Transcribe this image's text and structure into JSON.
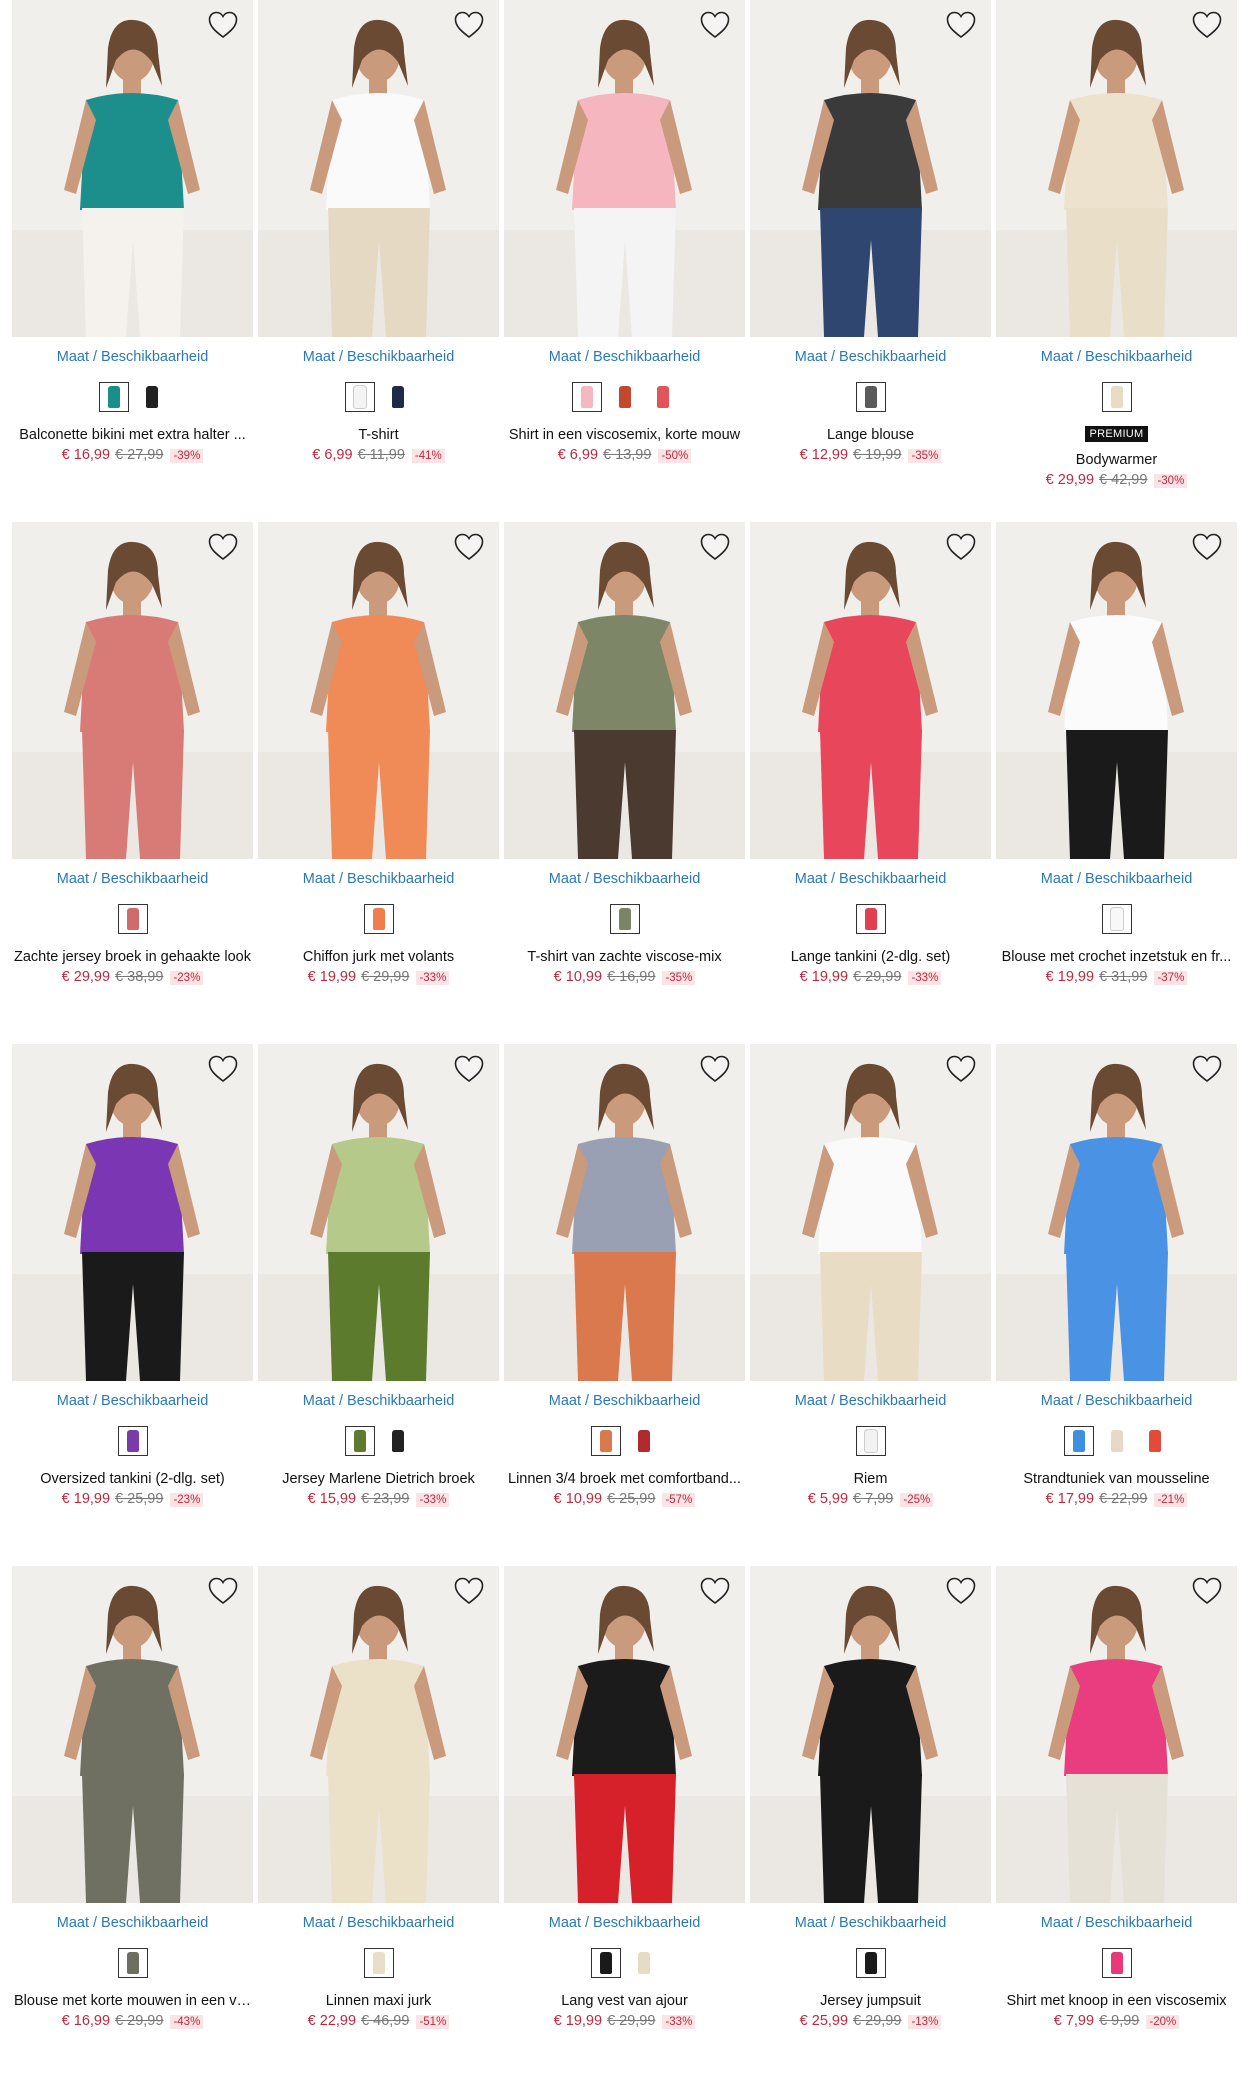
{
  "size_link_label": "Maat / Beschikbaarheid",
  "favorite_icon": "heart-outline-icon",
  "colors": {
    "price": "#c0283d",
    "link": "#2a79b6",
    "discount_bg": "#fbe3e6"
  },
  "products": [
    {
      "name": "Balconette bikini met extra halter ...",
      "price": "€ 16,99",
      "old_price": "€ 27,99",
      "discount": "-39%",
      "swatches": [
        "#1a8f8a",
        "#222222"
      ],
      "image_colors": [
        "#1c8f8c",
        "#f5f1ec"
      ],
      "premium": ""
    },
    {
      "name": "T-shirt",
      "price": "€ 6,99",
      "old_price": "€ 11,99",
      "discount": "-41%",
      "swatches": [
        "#f4f4f4",
        "#1e2a4a"
      ],
      "image_colors": [
        "#fafafa",
        "#e6d9c3"
      ],
      "premium": ""
    },
    {
      "name": "Shirt in een viscosemix, korte mouw",
      "price": "€ 6,99",
      "old_price": "€ 13,99",
      "discount": "-50%",
      "swatches": [
        "#f3b8c0",
        "#c2482e",
        "#e0545a"
      ],
      "image_colors": [
        "#f6b6bf",
        "#f4f4f4"
      ],
      "premium": ""
    },
    {
      "name": "Lange blouse",
      "price": "€ 12,99",
      "old_price": "€ 19,99",
      "discount": "-35%",
      "swatches": [
        "#5a5a5a"
      ],
      "image_colors": [
        "#3a3a3a",
        "#2f4670"
      ],
      "premium": ""
    },
    {
      "name": "Bodywarmer",
      "price": "€ 29,99",
      "old_price": "€ 42,99",
      "discount": "-30%",
      "swatches": [
        "#e7dcc6"
      ],
      "image_colors": [
        "#ece2cd",
        "#e9dfc9"
      ],
      "premium": "PREMIUM"
    },
    {
      "name": "Zachte jersey broek in gehaakte look",
      "price": "€ 29,99",
      "old_price": "€ 38,99",
      "discount": "-23%",
      "swatches": [
        "#d06b6b"
      ],
      "image_colors": [
        "#d87a76",
        "#d87a76"
      ],
      "premium": ""
    },
    {
      "name": "Chiffon jurk met volants",
      "price": "€ 19,99",
      "old_price": "€ 29,99",
      "discount": "-33%",
      "swatches": [
        "#ef7d4e"
      ],
      "image_colors": [
        "#f08a56",
        "#f08a56"
      ],
      "premium": ""
    },
    {
      "name": "T-shirt van zachte viscose-mix",
      "price": "€ 10,99",
      "old_price": "€ 16,99",
      "discount": "-35%",
      "swatches": [
        "#7c8466"
      ],
      "image_colors": [
        "#7e8668",
        "#4a3a30"
      ],
      "premium": ""
    },
    {
      "name": "Lange tankini (2-dlg. set)",
      "price": "€ 19,99",
      "old_price": "€ 29,99",
      "discount": "-33%",
      "swatches": [
        "#e04050"
      ],
      "image_colors": [
        "#e8465a",
        "#e8465a"
      ],
      "premium": ""
    },
    {
      "name": "Blouse met crochet inzetstuk en fr...",
      "price": "€ 19,99",
      "old_price": "€ 31,99",
      "discount": "-37%",
      "swatches": [
        "#f8f8f8"
      ],
      "image_colors": [
        "#fbfbfb",
        "#1a1a1a"
      ],
      "premium": ""
    },
    {
      "name": "Oversized tankini (2-dlg. set)",
      "price": "€ 19,99",
      "old_price": "€ 25,99",
      "discount": "-23%",
      "swatches": [
        "#7a3aa8"
      ],
      "image_colors": [
        "#7b36b3",
        "#1a1a1a"
      ],
      "premium": ""
    },
    {
      "name": "Jersey Marlene Dietrich broek",
      "price": "€ 15,99",
      "old_price": "€ 23,99",
      "discount": "-33%",
      "swatches": [
        "#5d7a2e",
        "#222222"
      ],
      "image_colors": [
        "#b4c98a",
        "#5c7b2c"
      ],
      "premium": ""
    },
    {
      "name": "Linnen 3/4 broek met comfortband...",
      "price": "€ 10,99",
      "old_price": "€ 25,99",
      "discount": "-57%",
      "swatches": [
        "#d77a4e",
        "#b02a2e"
      ],
      "image_colors": [
        "#9aa0b4",
        "#d9794d"
      ],
      "premium": ""
    },
    {
      "name": "Riem",
      "price": "€ 5,99",
      "old_price": "€ 7,99",
      "discount": "-25%",
      "swatches": [
        "#f2f2f2"
      ],
      "image_colors": [
        "#fafafa",
        "#e8dcc4"
      ],
      "premium": ""
    },
    {
      "name": "Strandtuniek van mousseline",
      "price": "€ 17,99",
      "old_price": "€ 22,99",
      "discount": "-21%",
      "swatches": [
        "#3d8fe0",
        "#e8d8c8",
        "#e24a3a"
      ],
      "image_colors": [
        "#4a92e4",
        "#4a92e4"
      ],
      "premium": ""
    },
    {
      "name": "Blouse met korte mouwen in een vi...",
      "price": "€ 16,99",
      "old_price": "€ 29,99",
      "discount": "-43%",
      "swatches": [
        "#6e6f60"
      ],
      "image_colors": [
        "#6f7062",
        "#6f7062"
      ],
      "premium": ""
    },
    {
      "name": "Linnen maxi jurk",
      "price": "€ 22,99",
      "old_price": "€ 46,99",
      "discount": "-51%",
      "swatches": [
        "#e9dfc8"
      ],
      "image_colors": [
        "#ebe0c8",
        "#ebe0c8"
      ],
      "premium": ""
    },
    {
      "name": "Lang vest van ajour",
      "price": "€ 19,99",
      "old_price": "€ 29,99",
      "discount": "-33%",
      "swatches": [
        "#1a1a1a",
        "#e6dcc6"
      ],
      "image_colors": [
        "#1b1b1b",
        "#d6202a"
      ],
      "premium": ""
    },
    {
      "name": "Jersey jumpsuit",
      "price": "€ 25,99",
      "old_price": "€ 29,99",
      "discount": "-13%",
      "swatches": [
        "#1a1a1a"
      ],
      "image_colors": [
        "#1a1a1a",
        "#1a1a1a"
      ],
      "premium": ""
    },
    {
      "name": "Shirt met knoop in een viscosemix",
      "price": "€ 7,99",
      "old_price": "€ 9,99",
      "discount": "-20%",
      "swatches": [
        "#e83a7a"
      ],
      "image_colors": [
        "#ea3d80",
        "#e6e1d6"
      ],
      "premium": ""
    }
  ]
}
